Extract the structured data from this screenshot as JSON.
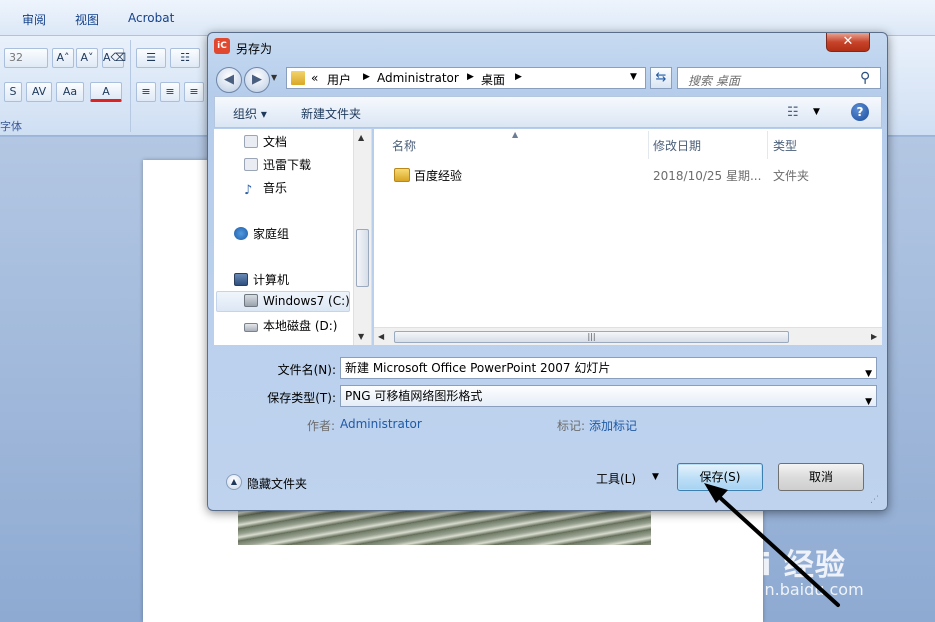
{
  "ribbon": {
    "tabs": [
      "审阅",
      "视图",
      "Acrobat"
    ],
    "font_size": "32",
    "grow_font": "A˄",
    "shrink_font": "A˅",
    "clear_format": "A⌫",
    "shadow": "S",
    "spacing": "AV",
    "change_case": "Aa",
    "font_color": "A",
    "font_group_label": "字体"
  },
  "dialog": {
    "title": "另存为",
    "title_icon_text": "iC",
    "close_glyph": "✕",
    "address": {
      "crumbs": [
        "«",
        "用户",
        "Administrator",
        "桌面"
      ]
    },
    "search_placeholder": "搜索 桌面",
    "toolbar": {
      "organize": "组织 ▾",
      "new_folder": "新建文件夹"
    },
    "nav": [
      {
        "label": "文档"
      },
      {
        "label": "迅雷下载"
      },
      {
        "label": "音乐"
      },
      {
        "label": "家庭组"
      },
      {
        "label": "计算机"
      },
      {
        "label": "Windows7 (C:)"
      },
      {
        "label": "本地磁盘 (D:)"
      }
    ],
    "columns": {
      "name": "名称",
      "modified": "修改日期",
      "type": "类型"
    },
    "files": [
      {
        "name": "百度经验",
        "modified": "2018/10/25 星期...",
        "type": "文件夹"
      }
    ],
    "file_name_label": "文件名(N):",
    "file_name_value": "新建 Microsoft Office PowerPoint 2007 幻灯片",
    "file_type_label": "保存类型(T):",
    "file_type_value": "PNG 可移植网络图形格式",
    "author_label": "作者:",
    "author_value": "Administrator",
    "tags_label": "标记:",
    "tags_value": "添加标记",
    "hide_folders": "隐藏文件夹",
    "tools": "工具(L)",
    "save": "保存(S)",
    "cancel": "取消"
  },
  "watermark": {
    "logo": "Bai 经验",
    "url": "jingyan.baidu.com"
  },
  "colors": {
    "accent_link": "#1f5aa6",
    "close_button": "#c7442b",
    "dialog_frame": "#b5cdeb"
  }
}
